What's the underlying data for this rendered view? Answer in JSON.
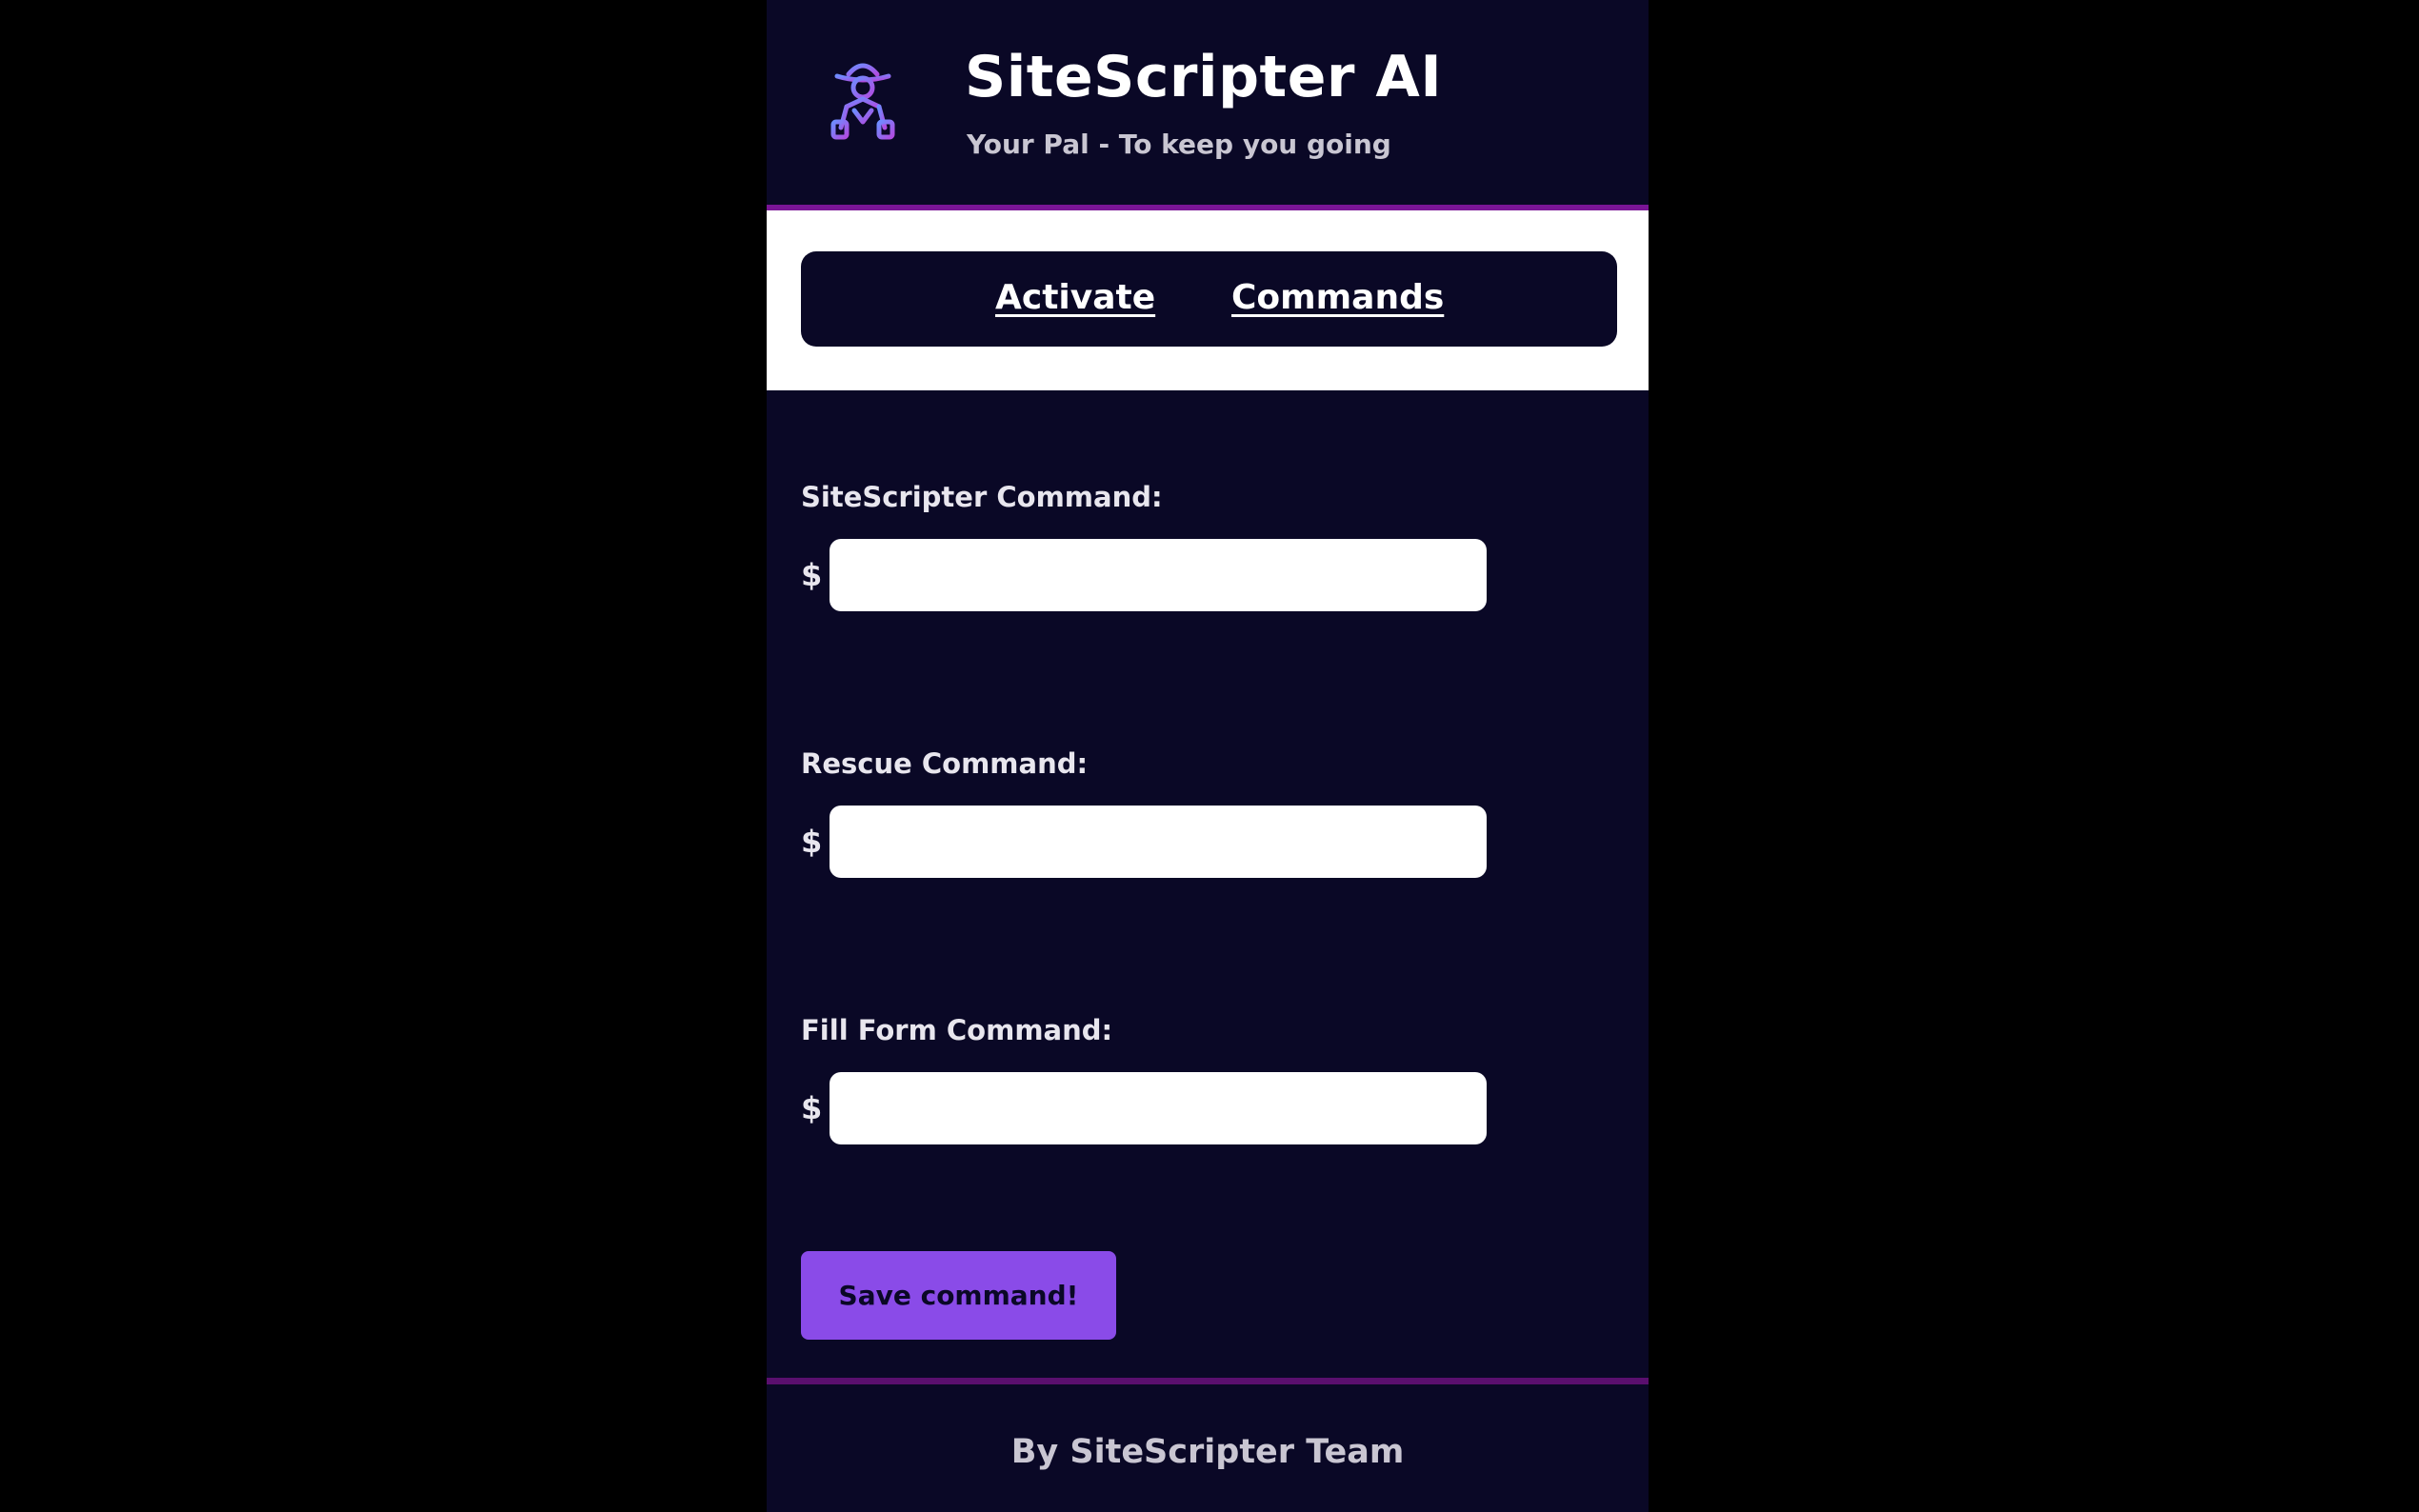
{
  "header": {
    "title": "SiteScripter AI",
    "subtitle": "Your Pal - To keep you going",
    "logo_icon": "detective-hat-icon"
  },
  "nav": {
    "items": [
      {
        "label": "Activate"
      },
      {
        "label": "Commands"
      }
    ]
  },
  "form": {
    "fields": [
      {
        "label": "SiteScripter Command:",
        "prefix": "$",
        "value": "",
        "placeholder": ""
      },
      {
        "label": "Rescue Command:",
        "prefix": "$",
        "value": "",
        "placeholder": ""
      },
      {
        "label": "Fill Form Command:",
        "prefix": "$",
        "value": "",
        "placeholder": ""
      }
    ],
    "save_label": "Save command!"
  },
  "footer": {
    "text": "By SiteScripter Team"
  },
  "colors": {
    "background": "#0a0826",
    "accent": "#8a4be8",
    "divider": "#7a1596"
  }
}
